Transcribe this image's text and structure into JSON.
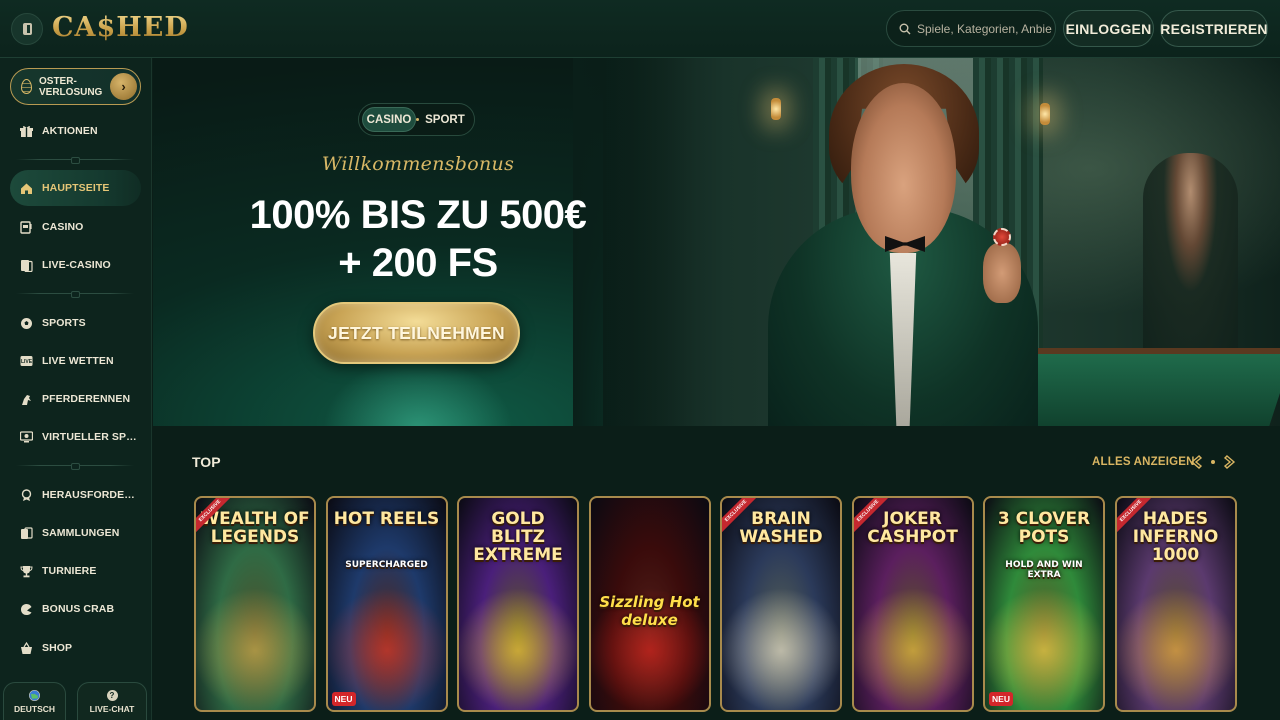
{
  "header": {
    "logo": "CA$HED",
    "search_placeholder": "Spiele, Kategorien, Anbieter",
    "login_label": "EINLOGGEN",
    "register_label": "REGISTRIEREN"
  },
  "sidebar": {
    "promo": {
      "label": "OSTER-\nVERLOSUNG",
      "chevron": "›"
    },
    "items": [
      {
        "label": "AKTIONEN",
        "icon": "gift-icon"
      },
      {
        "label": "HAUPTSEITE",
        "icon": "home-icon",
        "active": true
      },
      {
        "label": "CASINO",
        "icon": "slot-machine-icon"
      },
      {
        "label": "LIVE-CASINO",
        "icon": "cards-icon"
      },
      {
        "label": "SPORTS",
        "icon": "soccer-ball-icon"
      },
      {
        "label": "LIVE WETTEN",
        "icon": "live-icon"
      },
      {
        "label": "PFERDERENNEN",
        "icon": "horse-icon"
      },
      {
        "label": "VIRTUELLER SPORT",
        "icon": "virtual-sport-icon"
      },
      {
        "label": "HERAUSFORDERUN...",
        "icon": "challenge-icon"
      },
      {
        "label": "SAMMLUNGEN",
        "icon": "collection-icon"
      },
      {
        "label": "TURNIERE",
        "icon": "trophy-icon"
      },
      {
        "label": "BONUS CRAB",
        "icon": "crab-icon"
      },
      {
        "label": "SHOP",
        "icon": "basket-icon"
      }
    ],
    "bottom": {
      "language": "DEUTSCH",
      "chat": "LIVE-CHAT"
    }
  },
  "hero": {
    "toggle": {
      "casino": "CASINO",
      "sport": "SPORT"
    },
    "subtitle": "Willkommensbonus",
    "title_line1": "100% BIS ZU 500€",
    "title_line2": "+ 200 FS",
    "cta": "JETZT TEILNEHMEN"
  },
  "top_section": {
    "title": "TOP",
    "show_all": "ALLES ANZEIGEN",
    "games": [
      {
        "name": "WEALTH OF LEGENDS",
        "ribbon": "EXCLUSIVE",
        "new": false,
        "bg": "#2f6b45",
        "accent": "#d7b34f"
      },
      {
        "name": "HOT REELS",
        "sub": "SUPERCHARGED",
        "new": true,
        "new_label": "NEU",
        "bg": "#1e3a6b",
        "accent": "#e43b2b"
      },
      {
        "name": "GOLD BLITZ EXTREME",
        "new": false,
        "bg": "#4a1f7a",
        "accent": "#ffd23a"
      },
      {
        "name": "Sizzling Hot deluxe",
        "new": false,
        "bg": "#3a0b0b",
        "accent": "#e1261e"
      },
      {
        "name": "BRAIN WASHED",
        "ribbon": "EXCLUSIVE",
        "new": false,
        "bg": "#2b3a5a",
        "accent": "#f1e8d0"
      },
      {
        "name": "JOKER CASHPOT",
        "ribbon": "EXCLUSIVE",
        "new": false,
        "bg": "#5b1f5e",
        "accent": "#f5c542"
      },
      {
        "name": "3 CLOVER POTS",
        "sub": "HOLD AND WIN EXTRA",
        "new": true,
        "new_label": "NEU",
        "bg": "#2f8a3a",
        "accent": "#ffd84a"
      },
      {
        "name": "HADES INFERNO 1000",
        "ribbon": "EXCLUSIVE",
        "new": false,
        "bg": "#5b3a6e",
        "accent": "#f7b24a"
      }
    ]
  },
  "colors": {
    "accent_gold": "#d9b562",
    "background": "#0b1e18",
    "sidebar": "#0d241d"
  }
}
